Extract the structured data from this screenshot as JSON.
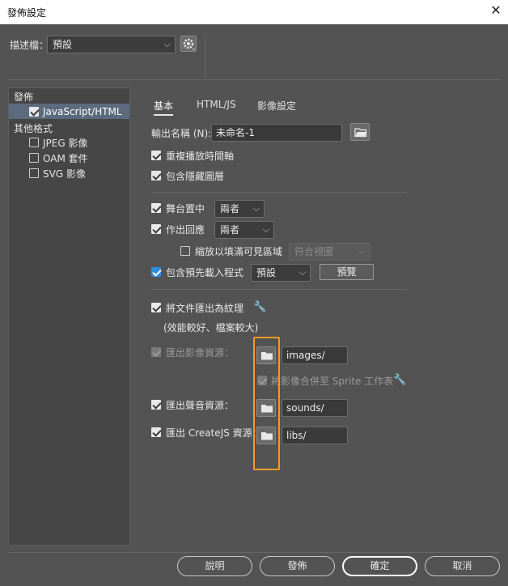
{
  "window": {
    "title": "發佈設定",
    "close_icon": "close-icon"
  },
  "profile": {
    "label": "描述檔：",
    "value": "預設",
    "gear_icon": "gear-icon"
  },
  "sidebar": {
    "publish_header": "發佈",
    "js_html_item": "JavaScript/HTML",
    "other_formats_header": "其他格式",
    "jpeg_item": "JPEG 影像",
    "oam_item": "OAM 套件",
    "svg_item": "SVG 影像"
  },
  "tabs": {
    "basic": "基本",
    "htmljs": "HTML/JS",
    "image_settings": "影像設定"
  },
  "output": {
    "label": "輸出名稱 (N):",
    "value": "未命名-1"
  },
  "options": {
    "loop_timeline": "重複播放時間軸",
    "include_hidden_layers": "包含隱藏圖層",
    "center_stage": "舞台置中",
    "center_stage_value": "兩者",
    "make_responsive": "作出回應",
    "make_responsive_value": "兩者",
    "scale_to_fill": "縮放以填滿可見區域",
    "scale_to_fill_value": "符合視圖",
    "include_preloader": "包含預先載入程式",
    "preloader_value": "預設",
    "preview_button": "預覽",
    "export_doc_texture": "將文件匯出為紋理",
    "export_doc_texture_note": "(效能較好、檔案較大)",
    "export_image_assets": "匯出影像資源：",
    "image_assets_path": "images/",
    "combine_sprite": "將影像合併至 Sprite 工作表",
    "export_sound_assets": "匯出聲音資源：",
    "sound_assets_path": "sounds/",
    "export_createjs_assets": "匯出 CreateJS 資源：",
    "createjs_assets_path": "libs/"
  },
  "footer": {
    "help": "說明",
    "publish": "發佈",
    "ok": "確定",
    "cancel": "取消"
  },
  "colors": {
    "background": "#535353",
    "highlight_box": "#f29a27",
    "selection": "#5b6b7d",
    "checkbox_blue": "#2f8de0"
  }
}
